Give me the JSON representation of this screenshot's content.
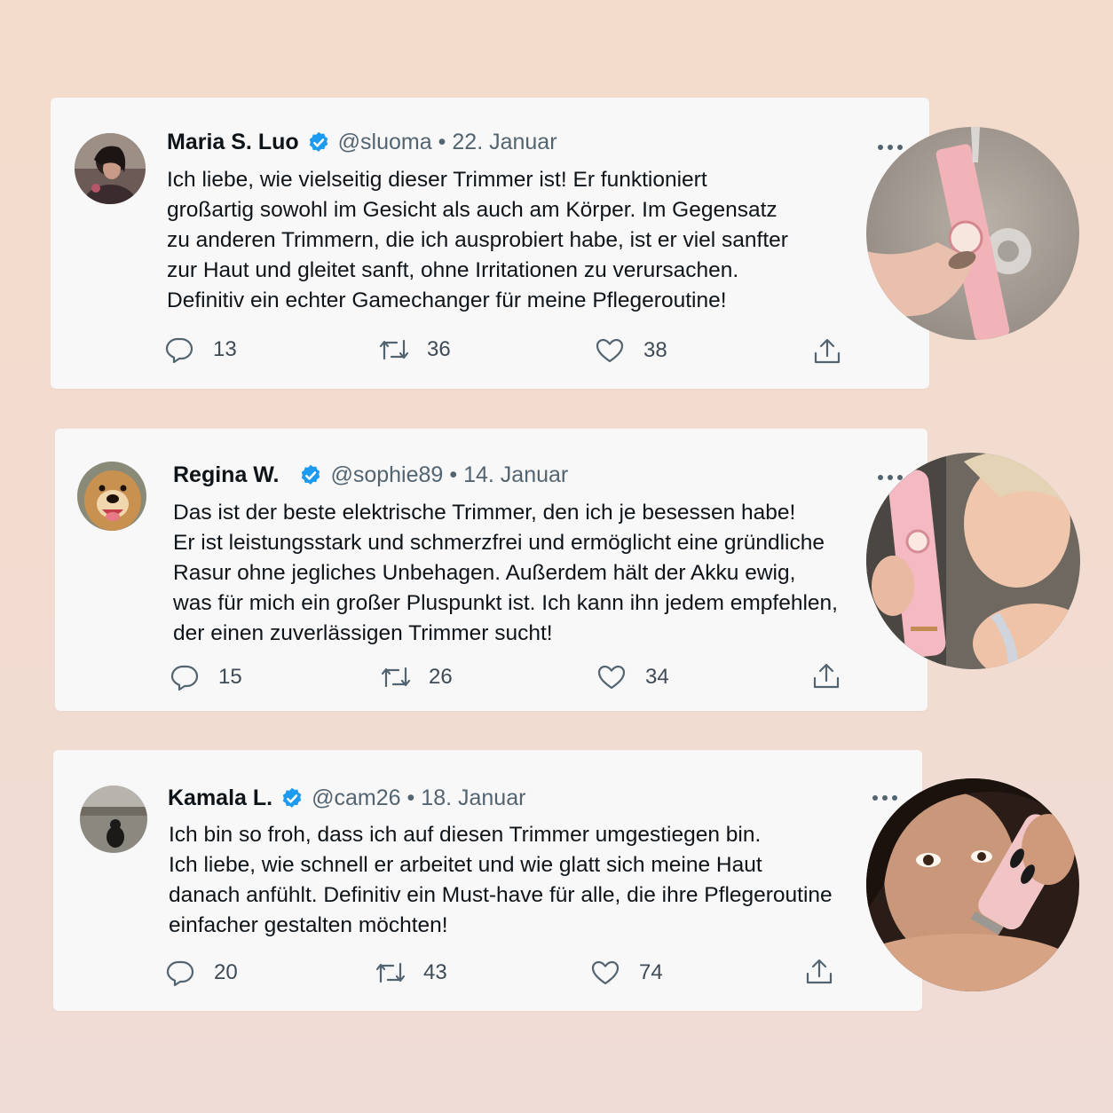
{
  "tweets": [
    {
      "name": "Maria S. Luo",
      "handle": "@sluoma",
      "date": "22. Januar",
      "lines": [
        "Ich liebe, wie vielseitig dieser Trimmer ist! Er funktioniert",
        "großartig sowohl im Gesicht als auch am Körper. Im Gegensatz",
        "zu anderen Trimmern, die ich ausprobiert habe, ist er viel sanfter",
        "zur Haut und gleitet sanft, ohne Irritationen zu verursachen.",
        "Definitiv ein echter Gamechanger für meine Pflegeroutine!"
      ],
      "replies": "13",
      "retweets": "36",
      "likes": "38"
    },
    {
      "name": "Regina W.",
      "handle": "@sophie89",
      "date": "14. Januar",
      "lines": [
        "Das ist der beste elektrische Trimmer, den ich je besessen habe!",
        "Er ist leistungsstark und schmerzfrei und ermöglicht eine gründliche",
        "Rasur ohne jegliches Unbehagen. Außerdem hält der Akku ewig,",
        "was für mich ein großer Pluspunkt ist. Ich kann ihn jedem empfehlen,",
        "der einen zuverlässigen Trimmer sucht!"
      ],
      "replies": "15",
      "retweets": "26",
      "likes": "34"
    },
    {
      "name": "Kamala L.",
      "handle": "@cam26",
      "date": "18. Januar",
      "lines": [
        "Ich bin so froh, dass ich auf diesen Trimmer umgestiegen bin.",
        "Ich liebe, wie schnell er arbeitet und wie glatt sich meine Haut",
        "danach anfühlt. Definitiv ein Must-have für alle, die ihre Pflegeroutine",
        "einfacher gestalten möchten!"
      ],
      "replies": "20",
      "retweets": "43",
      "likes": "74"
    }
  ],
  "separator": "•",
  "colors": {
    "verified": "#1d9bf0",
    "card": "#f8f8f8",
    "text": "#0f1419",
    "muted": "#536471"
  },
  "icons": [
    "verified-badge-icon",
    "more-icon",
    "reply-icon",
    "retweet-icon",
    "like-icon",
    "share-icon"
  ]
}
